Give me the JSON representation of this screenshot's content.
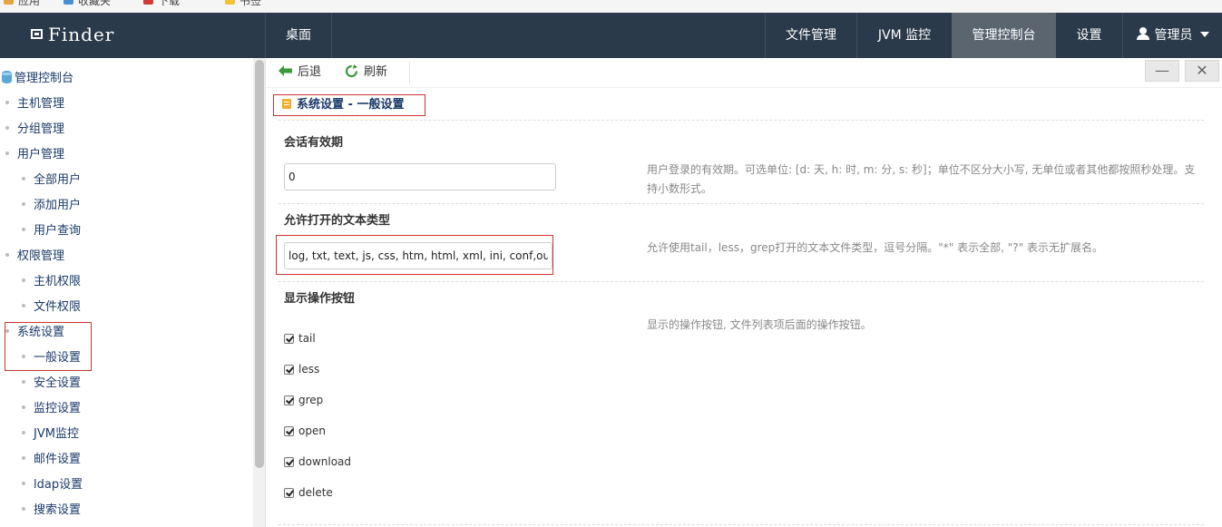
{
  "bookmarks": [
    {
      "label": "应用",
      "color": "#e8a33c"
    },
    {
      "label": "收藏夹",
      "color": "#4a8fd6"
    },
    {
      "label": "下载",
      "color": "#d23a3a"
    },
    {
      "label": "书签",
      "color": "#f1c232"
    }
  ],
  "header": {
    "logo": "Finder",
    "desktop": "桌面",
    "nav": [
      "文件管理",
      "JVM 监控",
      "管理控制台",
      "设置"
    ],
    "active_nav": "管理控制台",
    "user": "管理员"
  },
  "sidebar": {
    "root": "管理控制台",
    "items": [
      "主机管理",
      "分组管理",
      "用户管理",
      "全部用户",
      "添加用户",
      "用户查询",
      "权限管理",
      "主机权限",
      "文件权限",
      "系统设置",
      "一般设置",
      "安全设置",
      "监控设置",
      "JVM监控",
      "邮件设置",
      "ldap设置",
      "搜索设置"
    ]
  },
  "toolbar": {
    "back": "后退",
    "refresh": "刷新",
    "minimize": "—",
    "close": "✕"
  },
  "panel": {
    "title": "系统设置 - 一般设置",
    "session": {
      "label": "会话有效期",
      "value": "0",
      "help": "用户登录的有效期。可选单位: [d: 天, h: 时, m: 分, s: 秒]；单位不区分大小写, 无单位或者其他都按照秒处理。支持小数形式。"
    },
    "filetypes": {
      "label": "允许打开的文本类型",
      "value": "log, txt, text, js, css, htm, html, xml, ini, conf,out",
      "help": "允许使用tail，less，grep打开的文本文件类型，逗号分隔。\"*\" 表示全部, \"?\" 表示无扩展名。"
    },
    "buttons": {
      "label": "显示操作按钮",
      "help": "显示的操作按钮, 文件列表项后面的操作按钮。",
      "options": [
        "tail",
        "less",
        "grep",
        "open",
        "download",
        "delete"
      ]
    }
  }
}
